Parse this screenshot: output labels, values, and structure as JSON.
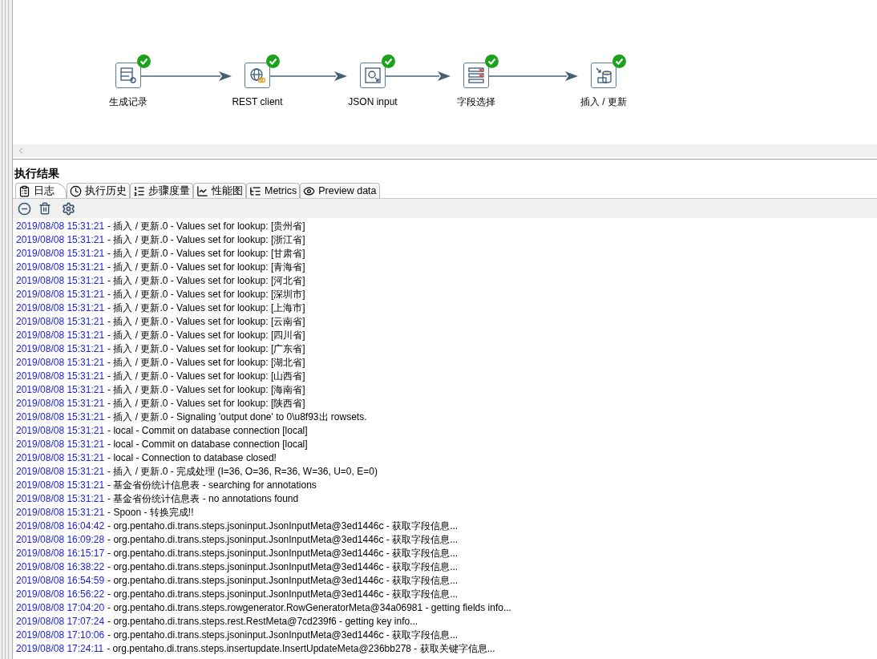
{
  "canvas": {
    "steps": [
      {
        "label": "生成记录",
        "kind": "generate",
        "finished": true
      },
      {
        "label": "REST client",
        "kind": "rest",
        "finished": true
      },
      {
        "label": "JSON input",
        "kind": "json",
        "finished": true
      },
      {
        "label": "字段选择",
        "kind": "select",
        "finished": true
      },
      {
        "label": "插入 / 更新",
        "kind": "insert",
        "finished": true
      }
    ]
  },
  "results": {
    "title": "执行结果",
    "tabs": [
      {
        "label": "日志",
        "kind": "log",
        "selected": true
      },
      {
        "label": "执行历史",
        "kind": "history",
        "selected": false
      },
      {
        "label": "步骤度量",
        "kind": "steps",
        "selected": false
      },
      {
        "label": "性能图",
        "kind": "perf",
        "selected": false
      },
      {
        "label": "Metrics",
        "kind": "metrics",
        "selected": false
      },
      {
        "label": "Preview data",
        "kind": "preview",
        "selected": false
      }
    ],
    "log": [
      {
        "time": "2019/08/08 15:31:21",
        "message": "- 插入 / 更新.0 - Values set for lookup: [贵州省]"
      },
      {
        "time": "2019/08/08 15:31:21",
        "message": "- 插入 / 更新.0 - Values set for lookup: [浙江省]"
      },
      {
        "time": "2019/08/08 15:31:21",
        "message": "- 插入 / 更新.0 - Values set for lookup: [甘肃省]"
      },
      {
        "time": "2019/08/08 15:31:21",
        "message": "- 插入 / 更新.0 - Values set for lookup: [青海省]"
      },
      {
        "time": "2019/08/08 15:31:21",
        "message": "- 插入 / 更新.0 - Values set for lookup: [河北省]"
      },
      {
        "time": "2019/08/08 15:31:21",
        "message": "- 插入 / 更新.0 - Values set for lookup: [深圳市]"
      },
      {
        "time": "2019/08/08 15:31:21",
        "message": "- 插入 / 更新.0 - Values set for lookup: [上海市]"
      },
      {
        "time": "2019/08/08 15:31:21",
        "message": "- 插入 / 更新.0 - Values set for lookup: [云南省]"
      },
      {
        "time": "2019/08/08 15:31:21",
        "message": "- 插入 / 更新.0 - Values set for lookup: [四川省]"
      },
      {
        "time": "2019/08/08 15:31:21",
        "message": "- 插入 / 更新.0 - Values set for lookup: [广东省]"
      },
      {
        "time": "2019/08/08 15:31:21",
        "message": "- 插入 / 更新.0 - Values set for lookup: [湖北省]"
      },
      {
        "time": "2019/08/08 15:31:21",
        "message": "- 插入 / 更新.0 - Values set for lookup: [山西省]"
      },
      {
        "time": "2019/08/08 15:31:21",
        "message": "- 插入 / 更新.0 - Values set for lookup: [海南省]"
      },
      {
        "time": "2019/08/08 15:31:21",
        "message": "- 插入 / 更新.0 - Values set for lookup: [陕西省]"
      },
      {
        "time": "2019/08/08 15:31:21",
        "message": "- 插入 / 更新.0 - Signaling 'output done' to 0\\u8f93出 rowsets."
      },
      {
        "time": "2019/08/08 15:31:21",
        "message": "- local - Commit on database connection [local]"
      },
      {
        "time": "2019/08/08 15:31:21",
        "message": "- local - Commit on database connection [local]"
      },
      {
        "time": "2019/08/08 15:31:21",
        "message": "- local - Connection to database closed!"
      },
      {
        "time": "2019/08/08 15:31:21",
        "message": "- 插入 / 更新.0 - 完成处理 (I=36, O=36, R=36, W=36, U=0, E=0)"
      },
      {
        "time": "2019/08/08 15:31:21",
        "message": "- 基金省份统计信息表 - searching for annotations"
      },
      {
        "time": "2019/08/08 15:31:21",
        "message": "- 基金省份统计信息表 - no annotations found"
      },
      {
        "time": "2019/08/08 15:31:21",
        "message": "- Spoon - 转换完成!!"
      },
      {
        "time": "2019/08/08 16:04:42",
        "message": "- org.pentaho.di.trans.steps.jsoninput.JsonInputMeta@3ed1446c - 获取字段信息..."
      },
      {
        "time": "2019/08/08 16:09:28",
        "message": "- org.pentaho.di.trans.steps.jsoninput.JsonInputMeta@3ed1446c - 获取字段信息..."
      },
      {
        "time": "2019/08/08 16:15:17",
        "message": "- org.pentaho.di.trans.steps.jsoninput.JsonInputMeta@3ed1446c - 获取字段信息..."
      },
      {
        "time": "2019/08/08 16:38:22",
        "message": "- org.pentaho.di.trans.steps.jsoninput.JsonInputMeta@3ed1446c - 获取字段信息..."
      },
      {
        "time": "2019/08/08 16:54:59",
        "message": "- org.pentaho.di.trans.steps.jsoninput.JsonInputMeta@3ed1446c - 获取字段信息..."
      },
      {
        "time": "2019/08/08 16:56:22",
        "message": "- org.pentaho.di.trans.steps.jsoninput.JsonInputMeta@3ed1446c - 获取字段信息..."
      },
      {
        "time": "2019/08/08 17:04:20",
        "message": "- org.pentaho.di.trans.steps.rowgenerator.RowGeneratorMeta@34a06981 - getting fields info..."
      },
      {
        "time": "2019/08/08 17:07:24",
        "message": "- org.pentaho.di.trans.steps.rest.RestMeta@7cd239f6 - getting key info..."
      },
      {
        "time": "2019/08/08 17:10:06",
        "message": "- org.pentaho.di.trans.steps.jsoninput.JsonInputMeta@3ed1446c - 获取字段信息..."
      },
      {
        "time": "2019/08/08 17:24:11",
        "message": "- org.pentaho.di.trans.steps.insertupdate.InsertUpdateMeta@236bb278 - 获取关键字信息..."
      }
    ]
  }
}
